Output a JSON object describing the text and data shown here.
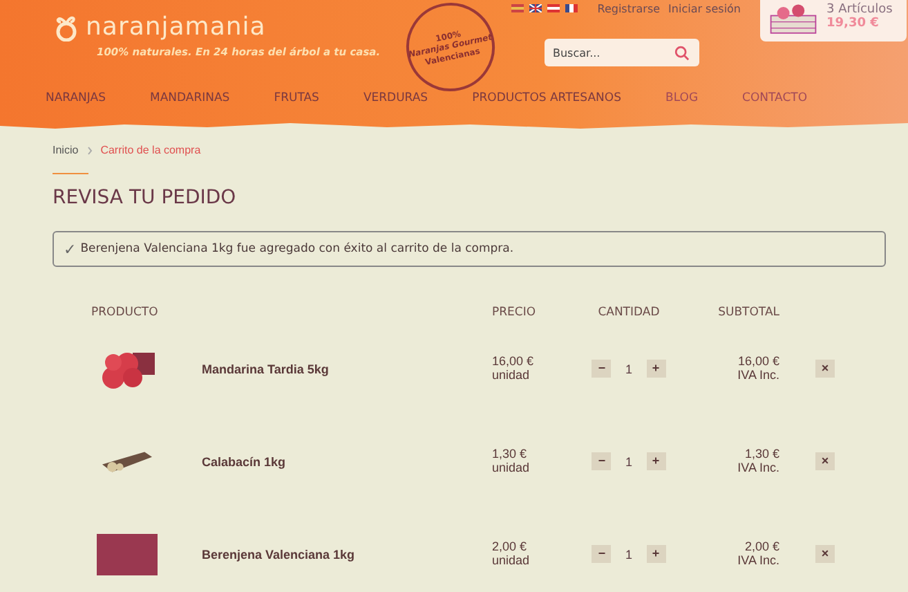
{
  "header": {
    "logo": "naranjamania",
    "tagline": "100% naturales. En 24 horas del árbol a tu casa.",
    "stamp": [
      "100%",
      "Naranjas Gourmet",
      "Valencianas"
    ],
    "account_links": [
      "Registrarse",
      "Iniciar sesión"
    ],
    "search": {
      "placeholder": "Buscar..."
    },
    "cart": {
      "count": "3 Artículos",
      "total": "19,30 €"
    }
  },
  "nav": [
    "NARANJAS",
    "MANDARINAS",
    "FRUTAS",
    "VERDURAS",
    "PRODUCTOS ARTESANOS",
    "BLOG",
    "CONTACTO"
  ],
  "breadcrumb": [
    {
      "label": "Inicio",
      "selected": false
    },
    {
      "label": "Carrito de la compra",
      "selected": true
    }
  ],
  "title": "REVISA TU PEDIDO",
  "notice": {
    "icon": "✓",
    "text": "Berenjena Valenciana 1kg fue agregado con éxito al carrito de la compra."
  },
  "table": {
    "columns": [
      "PRODUCTO",
      "PRECIO",
      "CANTIDAD",
      "SUBTOTAL"
    ],
    "rows": [
      {
        "kind": "mandarin",
        "name": "Mandarina Tardia 5kg",
        "price": "16,00 €",
        "unit": "unidad",
        "minus": "−",
        "qty": "1",
        "plus": "+",
        "subtotal": "16,00 €",
        "tax": "IVA Inc.",
        "remove": "×"
      },
      {
        "kind": "zucchini",
        "name": "Calabacín 1kg",
        "price": "1,30 €",
        "unit": "unidad",
        "minus": "−",
        "qty": "1",
        "plus": "+",
        "subtotal": "1,30 €",
        "tax": "IVA Inc.",
        "remove": "×"
      },
      {
        "kind": "eggplant",
        "name": "Berenjena Valenciana 1kg",
        "price": "2,00 €",
        "unit": "unidad",
        "minus": "−",
        "qty": "1",
        "plus": "+",
        "subtotal": "2,00 €",
        "tax": "IVA Inc.",
        "remove": "×"
      }
    ]
  }
}
